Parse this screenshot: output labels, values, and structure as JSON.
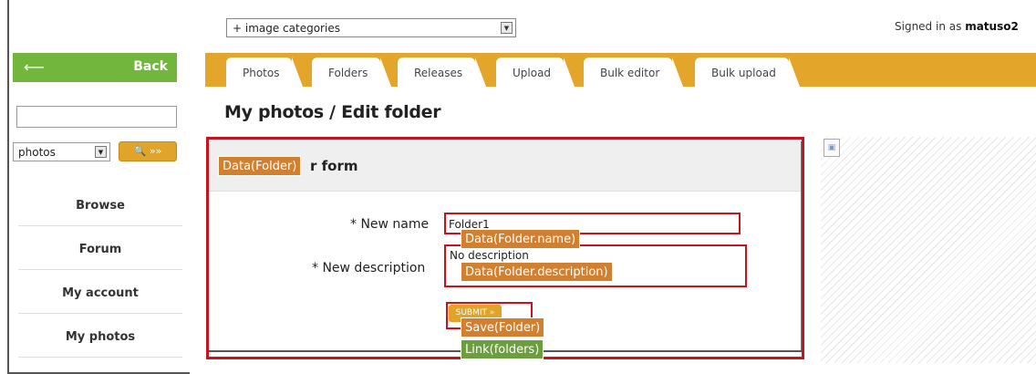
{
  "header": {
    "category_select": "+ image categories",
    "signed_in_prefix": "Signed in as",
    "username": "matuso2"
  },
  "sidebar": {
    "back_label": "Back",
    "search_scope": "photos",
    "search_button": "»»",
    "items": [
      "Browse",
      "Forum",
      "My account",
      "My photos"
    ]
  },
  "tabs": [
    "Photos",
    "Folders",
    "Releases",
    "Upload",
    "Bulk editor",
    "Bulk upload"
  ],
  "page_title": "My photos / Edit folder",
  "form": {
    "header": "r form",
    "name_label": "* New name",
    "name_value": "Folder1",
    "description_label": "* New description",
    "description_value": "No description",
    "submit_label": "SUBMIT »"
  },
  "annotations": {
    "folder": "Data(Folder)",
    "folder_name": "Data(Folder.name)",
    "folder_description": "Data(Folder.description)",
    "save": "Save(Folder)",
    "link": "Link(folders)"
  },
  "colors": {
    "accent_orange": "#e4a52b",
    "back_green": "#73b63d",
    "annotation_red": "#c7131d",
    "tag_orange": "#d1802f",
    "tag_green": "#6c9d3e"
  },
  "icons": {
    "back": "back-arrow-icon",
    "search": "magnifier-icon",
    "broken_image": "broken-image-icon"
  }
}
